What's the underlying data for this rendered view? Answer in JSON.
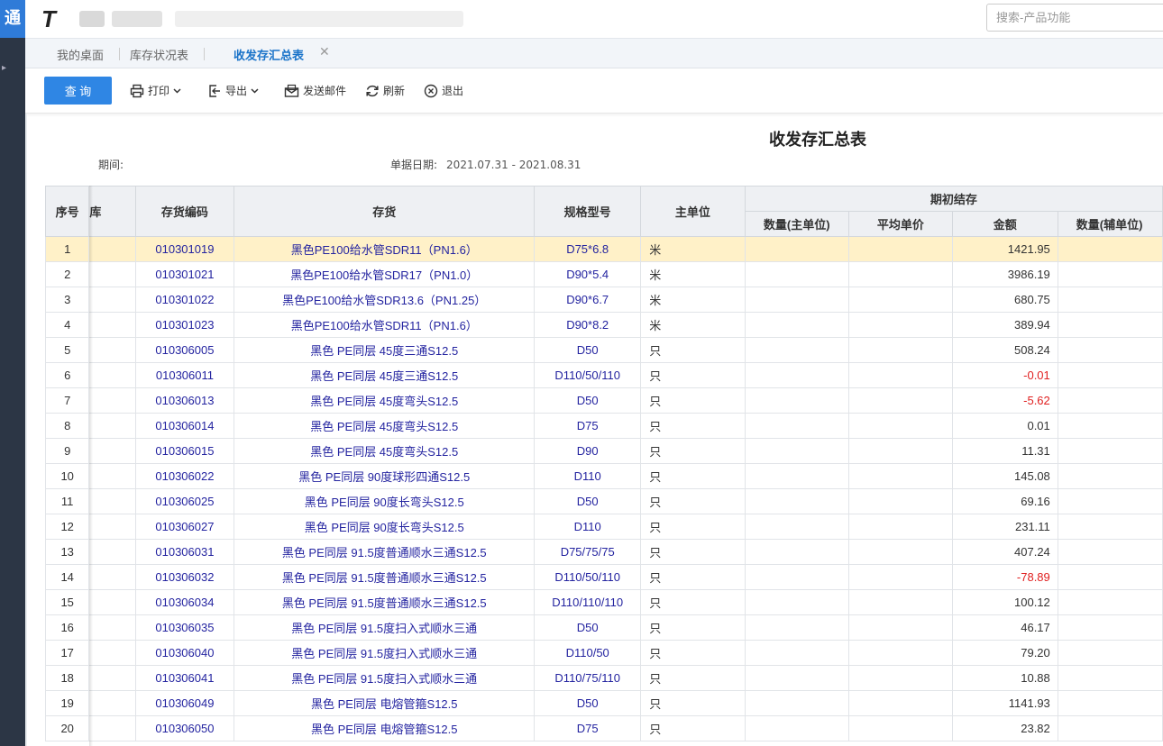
{
  "sidebar": {
    "logo_char": "通"
  },
  "header": {
    "brand": "T",
    "search_placeholder": "搜索-产品功能"
  },
  "tabs": [
    {
      "label": "我的桌面"
    },
    {
      "label": "库存状况表"
    },
    {
      "label": "收发存汇总表",
      "active": true
    }
  ],
  "toolbar": {
    "query": "查 询",
    "print": "打印",
    "export": "导出",
    "email": "发送邮件",
    "refresh": "刷新",
    "exit": "退出"
  },
  "report": {
    "title": "收发存汇总表",
    "period_label": "期间:",
    "date_label": "单据日期:",
    "date_value": "2021.07.31 - 2021.08.31"
  },
  "table": {
    "headers": {
      "index": "序号",
      "frozen_partial": "库",
      "code": "存货编码",
      "item": "存货",
      "spec": "规格型号",
      "unit": "主单位",
      "opening_group": "期初结存",
      "qty_main": "数量(主单位)",
      "avg_price": "平均单价",
      "amount": "金额",
      "qty_aux": "数量(辅单位)"
    },
    "rows": [
      {
        "idx": "1",
        "code": "010301019",
        "name": "黑色PE100给水管SDR11（PN1.6）",
        "spec": "D75*6.8",
        "unit": "米",
        "amount": "1421.95"
      },
      {
        "idx": "2",
        "code": "010301021",
        "name": "黑色PE100给水管SDR17（PN1.0）",
        "spec": "D90*5.4",
        "unit": "米",
        "amount": "3986.19"
      },
      {
        "idx": "3",
        "code": "010301022",
        "name": "黑色PE100给水管SDR13.6（PN1.25）",
        "spec": "D90*6.7",
        "unit": "米",
        "amount": "680.75"
      },
      {
        "idx": "4",
        "code": "010301023",
        "name": "黑色PE100给水管SDR11（PN1.6）",
        "spec": "D90*8.2",
        "unit": "米",
        "amount": "389.94"
      },
      {
        "idx": "5",
        "code": "010306005",
        "name": "黑色 PE同层 45度三通S12.5",
        "spec": "D50",
        "unit": "只",
        "amount": "508.24"
      },
      {
        "idx": "6",
        "code": "010306011",
        "name": "黑色 PE同层 45度三通S12.5",
        "spec": "D110/50/110",
        "unit": "只",
        "amount": "-0.01"
      },
      {
        "idx": "7",
        "code": "010306013",
        "name": "黑色 PE同层 45度弯头S12.5",
        "spec": "D50",
        "unit": "只",
        "amount": "-5.62"
      },
      {
        "idx": "8",
        "code": "010306014",
        "name": "黑色 PE同层 45度弯头S12.5",
        "spec": "D75",
        "unit": "只",
        "amount": "0.01"
      },
      {
        "idx": "9",
        "code": "010306015",
        "name": "黑色 PE同层 45度弯头S12.5",
        "spec": "D90",
        "unit": "只",
        "amount": "11.31"
      },
      {
        "idx": "10",
        "code": "010306022",
        "name": "黑色 PE同层 90度球形四通S12.5",
        "spec": "D110",
        "unit": "只",
        "amount": "145.08"
      },
      {
        "idx": "11",
        "code": "010306025",
        "name": "黑色 PE同层 90度长弯头S12.5",
        "spec": "D50",
        "unit": "只",
        "amount": "69.16"
      },
      {
        "idx": "12",
        "code": "010306027",
        "name": "黑色 PE同层 90度长弯头S12.5",
        "spec": "D110",
        "unit": "只",
        "amount": "231.11"
      },
      {
        "idx": "13",
        "code": "010306031",
        "name": "黑色 PE同层 91.5度普通顺水三通S12.5",
        "spec": "D75/75/75",
        "unit": "只",
        "amount": "407.24"
      },
      {
        "idx": "14",
        "code": "010306032",
        "name": "黑色 PE同层 91.5度普通顺水三通S12.5",
        "spec": "D110/50/110",
        "unit": "只",
        "amount": "-78.89"
      },
      {
        "idx": "15",
        "code": "010306034",
        "name": "黑色 PE同层 91.5度普通顺水三通S12.5",
        "spec": "D110/110/110",
        "unit": "只",
        "amount": "100.12"
      },
      {
        "idx": "16",
        "code": "010306035",
        "name": "黑色 PE同层 91.5度扫入式顺水三通",
        "spec": "D50",
        "unit": "只",
        "amount": "46.17"
      },
      {
        "idx": "17",
        "code": "010306040",
        "name": "黑色 PE同层 91.5度扫入式顺水三通",
        "spec": "D110/50",
        "unit": "只",
        "amount": "79.20"
      },
      {
        "idx": "18",
        "code": "010306041",
        "name": "黑色 PE同层 91.5度扫入式顺水三通",
        "spec": "D110/75/110",
        "unit": "只",
        "amount": "10.88"
      },
      {
        "idx": "19",
        "code": "010306049",
        "name": "黑色 PE同层 电熔管箍S12.5",
        "spec": "D50",
        "unit": "只",
        "amount": "1141.93"
      },
      {
        "idx": "20",
        "code": "010306050",
        "name": "黑色 PE同层 电熔管箍S12.5",
        "spec": "D75",
        "unit": "只",
        "amount": "23.82"
      }
    ]
  },
  "colors": {
    "accent": "#2f86e4",
    "negative": "#e02020",
    "selected_row": "#fff1c8",
    "link_text": "#2424a0"
  }
}
